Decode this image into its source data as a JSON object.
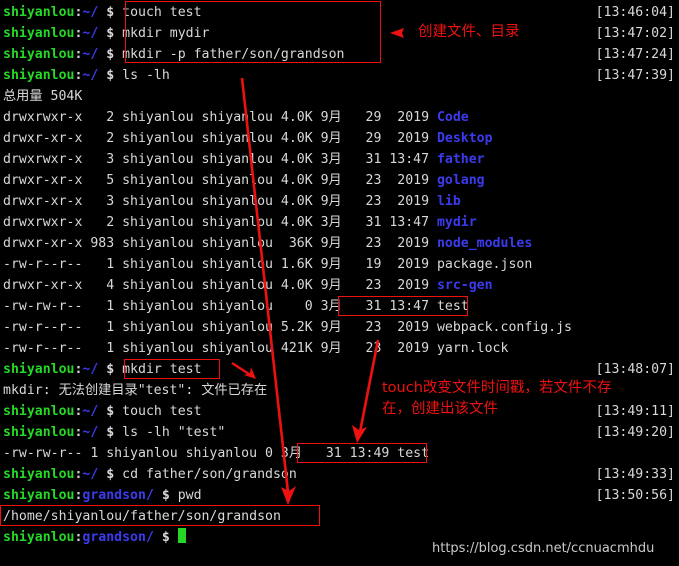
{
  "terminal": {
    "background": "#000000",
    "foreground": "#d8d8d8",
    "user_color": "#26d826",
    "path_color": "#3b3bee",
    "annotation_color": "#ee1111",
    "prompt": {
      "user": "shiyanlou",
      "colon": ":",
      "path_home": "~/",
      "path_grandson": "grandson/",
      "dollar": " $ "
    }
  },
  "lines": [
    {
      "type": "prompt",
      "path": "~/",
      "command": "touch test",
      "timestamp": "[13:46:04]"
    },
    {
      "type": "prompt",
      "path": "~/",
      "command": "mkdir mydir",
      "timestamp": "[13:47:02]"
    },
    {
      "type": "prompt",
      "path": "~/",
      "command": "mkdir -p father/son/grandson",
      "timestamp": "[13:47:24]"
    },
    {
      "type": "prompt",
      "path": "~/",
      "command": "ls -lh",
      "timestamp": "[13:47:39]"
    },
    {
      "type": "output",
      "text": "总用量 504K",
      "timestamp": ""
    },
    {
      "type": "listing",
      "perms": "drwxrwxr-x",
      "links": "2",
      "owner": "shiyanlou",
      "group": "shiyanlou",
      "size": "4.0K",
      "month": "9月",
      "day": "29",
      "time": "2019",
      "name": "Code",
      "name_kind": "dir",
      "timestamp": ""
    },
    {
      "type": "listing",
      "perms": "drwxr-xr-x",
      "links": "2",
      "owner": "shiyanlou",
      "group": "shiyanlou",
      "size": "4.0K",
      "month": "9月",
      "day": "29",
      "time": "2019",
      "name": "Desktop",
      "name_kind": "dir",
      "timestamp": ""
    },
    {
      "type": "listing",
      "perms": "drwxrwxr-x",
      "links": "3",
      "owner": "shiyanlou",
      "group": "shiyanlou",
      "size": "4.0K",
      "month": "3月",
      "day": "31",
      "time": "13:47",
      "name": "father",
      "name_kind": "dir",
      "timestamp": ""
    },
    {
      "type": "listing",
      "perms": "drwxr-xr-x",
      "links": "5",
      "owner": "shiyanlou",
      "group": "shiyanlou",
      "size": "4.0K",
      "month": "9月",
      "day": "23",
      "time": "2019",
      "name": "golang",
      "name_kind": "dir",
      "timestamp": ""
    },
    {
      "type": "listing",
      "perms": "drwxr-xr-x",
      "links": "3",
      "owner": "shiyanlou",
      "group": "shiyanlou",
      "size": "4.0K",
      "month": "9月",
      "day": "23",
      "time": "2019",
      "name": "lib",
      "name_kind": "dir",
      "timestamp": ""
    },
    {
      "type": "listing",
      "perms": "drwxrwxr-x",
      "links": "2",
      "owner": "shiyanlou",
      "group": "shiyanlou",
      "size": "4.0K",
      "month": "3月",
      "day": "31",
      "time": "13:47",
      "name": "mydir",
      "name_kind": "dir",
      "timestamp": ""
    },
    {
      "type": "listing",
      "perms": "drwxr-xr-x",
      "links": "983",
      "owner": "shiyanlou",
      "group": "shiyanlou",
      "size": "36K",
      "month": "9月",
      "day": "23",
      "time": "2019",
      "name": "node_modules",
      "name_kind": "dir",
      "timestamp": ""
    },
    {
      "type": "listing",
      "perms": "-rw-r--r--",
      "links": "1",
      "owner": "shiyanlou",
      "group": "shiyanlou",
      "size": "1.6K",
      "month": "9月",
      "day": "19",
      "time": "2019",
      "name": "package.json",
      "name_kind": "file",
      "timestamp": ""
    },
    {
      "type": "listing",
      "perms": "drwxr-xr-x",
      "links": "4",
      "owner": "shiyanlou",
      "group": "shiyanlou",
      "size": "4.0K",
      "month": "9月",
      "day": "23",
      "time": "2019",
      "name": "src-gen",
      "name_kind": "dir",
      "timestamp": ""
    },
    {
      "type": "listing",
      "perms": "-rw-rw-r--",
      "links": "1",
      "owner": "shiyanlou",
      "group": "shiyanlou",
      "size": "0",
      "month": "3月",
      "day": "31",
      "time": "13:47",
      "name": "test",
      "name_kind": "file",
      "timestamp": ""
    },
    {
      "type": "listing",
      "perms": "-rw-r--r--",
      "links": "1",
      "owner": "shiyanlou",
      "group": "shiyanlou",
      "size": "5.2K",
      "month": "9月",
      "day": "23",
      "time": "2019",
      "name": "webpack.config.js",
      "name_kind": "file",
      "timestamp": ""
    },
    {
      "type": "listing",
      "perms": "-rw-r--r--",
      "links": "1",
      "owner": "shiyanlou",
      "group": "shiyanlou",
      "size": "421K",
      "month": "9月",
      "day": "23",
      "time": "2019",
      "name": "yarn.lock",
      "name_kind": "file",
      "timestamp": ""
    },
    {
      "type": "prompt",
      "path": "~/",
      "command": "mkdir test",
      "timestamp": "[13:48:07]"
    },
    {
      "type": "output",
      "text": "mkdir: 无法创建目录\"test\": 文件已存在",
      "timestamp": ""
    },
    {
      "type": "prompt",
      "path": "~/",
      "command": "touch test",
      "timestamp": "[13:49:11]"
    },
    {
      "type": "prompt",
      "path": "~/",
      "command": "ls -lh \"test\"",
      "timestamp": "[13:49:20]"
    },
    {
      "type": "output",
      "text": "-rw-rw-r-- 1 shiyanlou shiyanlou 0 3月  31 13:49 test",
      "timestamp": ""
    },
    {
      "type": "prompt",
      "path": "~/",
      "command": "cd father/son/grandson",
      "timestamp": "[13:49:33]"
    },
    {
      "type": "prompt",
      "path": "grandson/",
      "command": "pwd",
      "timestamp": "[13:50:56]"
    },
    {
      "type": "output",
      "text": "/home/shiyanlou/father/son/grandson",
      "timestamp": ""
    },
    {
      "type": "prompt_cursor",
      "path": "grandson/",
      "command": "",
      "timestamp": ""
    }
  ],
  "raw_lines": {
    "line0_cmd": "touch test",
    "line1_cmd": "mkdir mydir",
    "line2_cmd": "mkdir -p father/son/grandson",
    "line3_cmd": "ls -lh",
    "total_line": "总用量 504K",
    "row_code": "drwxrwxr-x   2 shiyanlou shiyanlou 4.0K 9月   29  2019 ",
    "row_desktop": "drwxr-xr-x   2 shiyanlou shiyanlou 4.0K 9月   29  2019 ",
    "row_father": "drwxrwxr-x   3 shiyanlou shiyanlou 4.0K 3月   31 13:47 ",
    "row_golang": "drwxr-xr-x   5 shiyanlou shiyanlou 4.0K 9月   23  2019 ",
    "row_lib": "drwxr-xr-x   3 shiyanlou shiyanlou 4.0K 9月   23  2019 ",
    "row_mydir": "drwxrwxr-x   2 shiyanlou shiyanlou 4.0K 3月   31 13:47 ",
    "row_node_modules": "drwxr-xr-x 983 shiyanlou shiyanlou  36K 9月   23  2019 ",
    "row_package": "-rw-r--r--   1 shiyanlou shiyanlou 1.6K 9月   19  2019 ",
    "row_srcgen": "drwxr-xr-x   4 shiyanlou shiyanlou 4.0K 9月   23  2019 ",
    "row_test_pre": "-rw-rw-r--   1 shiyanlou shiyanlou    0 ",
    "row_test_boxed": "3月   31 13:47 test",
    "row_webpack": "-rw-r--r--   1 shiyanlou shiyanlou 5.2K 9月   23  2019 ",
    "row_yarn": "-rw-r--r--   1 shiyanlou shiyanlou 421K 9月   23  2019 ",
    "mkdir_err": "mkdir: 无法创建目录\"test\": 文件已存在",
    "ls_test_pre": "-rw-rw-r-- 1 shiyanlou shiyanlou 0 ",
    "ls_test_boxed": "3月   31 13:49 test",
    "pwd_out": "/home/shiyanlou/father/son/grandson",
    "cmd_mkdir_test": "mkdir test",
    "cmd_touch_test": "touch test",
    "cmd_ls_test": "ls -lh \"test\"",
    "cmd_cd": "cd father/son/grandson",
    "cmd_pwd": "pwd"
  },
  "names": {
    "code": "Code",
    "desktop": "Desktop",
    "father": "father",
    "golang": "golang",
    "lib": "lib",
    "mydir": "mydir",
    "node_modules": "node_modules",
    "package_json": "package.json",
    "src_gen": "src-gen",
    "webpack": "webpack.config.js",
    "yarn": "yarn.lock"
  },
  "timestamps": {
    "t1": "[13:46:04]",
    "t2": "[13:47:02]",
    "t3": "[13:47:24]",
    "t4": "[13:47:39]",
    "t5": "[13:48:07]",
    "t6": "[13:49:11]",
    "t7": "[13:49:20]",
    "t8": "[13:49:33]",
    "t9": "[13:50:56]"
  },
  "annotations": [
    {
      "id": "anno1",
      "text": "创建文件、目录",
      "color": "#ee1111"
    },
    {
      "id": "anno2",
      "line1": "touch改变文件时间戳，若文件不存",
      "line2": "在，创建出该文件",
      "color": "#ee1111"
    }
  ],
  "annotation_texts": {
    "create_file_dir": "创建文件、目录",
    "touch_desc_line1": "touch改变文件时间戳，若文件不存",
    "touch_desc_line2": "在，创建出该文件"
  },
  "watermark": "https://blog.csdn.net/ccnuacmhdu"
}
